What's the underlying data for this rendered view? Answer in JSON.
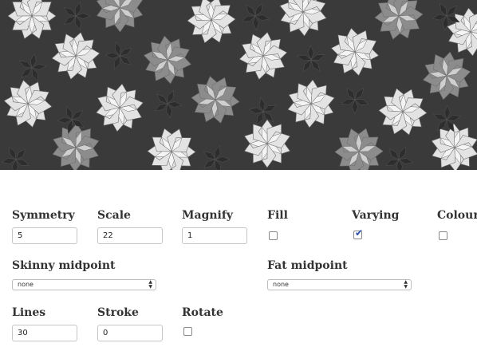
{
  "controls": {
    "symmetry": {
      "label": "Symmetry",
      "value": "5"
    },
    "scale": {
      "label": "Scale",
      "value": "22"
    },
    "magnify": {
      "label": "Magnify",
      "value": "1"
    },
    "fill": {
      "label": "Fill",
      "checked": false
    },
    "varying": {
      "label": "Varying",
      "checked": true
    },
    "colours": {
      "label": "Colours",
      "checked": false
    },
    "skinny_midpoint": {
      "label": "Skinny midpoint",
      "selected": "none"
    },
    "fat_midpoint": {
      "label": "Fat midpoint",
      "selected": "none"
    },
    "lines": {
      "label": "Lines",
      "value": "30"
    },
    "stroke": {
      "label": "Stroke",
      "value": "0"
    },
    "rotate": {
      "label": "Rotate",
      "checked": false
    }
  },
  "tiling": {
    "colors": {
      "dark": "#3a3a3a",
      "mid": "#8c8c8c",
      "light": "#e3e3e3",
      "edge": "#6f6f6f"
    }
  }
}
